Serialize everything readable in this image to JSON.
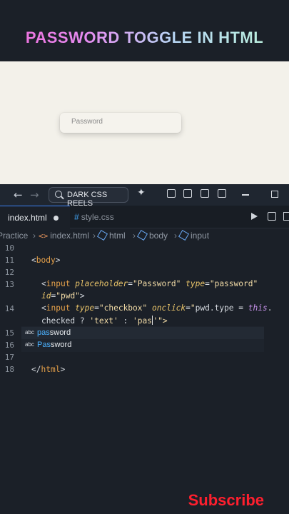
{
  "banner": {
    "title": "PASSWORD TOGGLE IN HTML"
  },
  "preview": {
    "input_placeholder": "Password"
  },
  "titlebar": {
    "back_icon": "arrow-left-icon",
    "forward_icon": "arrow-right-icon",
    "search_text": "DARK CSS REELS",
    "search_icon": "search-icon"
  },
  "tabs": [
    {
      "label": "index.html",
      "active": true,
      "modified": true
    },
    {
      "label": "style.css",
      "active": false,
      "prefix": "#"
    }
  ],
  "breadcrumb": {
    "items": [
      "Practice",
      "index.html",
      "html",
      "body",
      "input"
    ]
  },
  "editor": {
    "line_numbers": [
      "10",
      "11",
      "12",
      "13",
      "",
      "14",
      "",
      "15",
      "16",
      "17",
      "18"
    ],
    "lines": {
      "l11": {
        "open": "<",
        "name": "body",
        "close": ">"
      },
      "l13": {
        "open": "<",
        "tag": "input",
        "attr1": "placeholder",
        "eq1": "=",
        "val1": "\"Password\"",
        "attr2": "type",
        "eq2": "=",
        "val2": "\"password\"",
        "attr3": "id",
        "eq3": "=",
        "val3": "\"pwd\"",
        "close": ">"
      },
      "l14": {
        "open": "<",
        "tag": "input",
        "attr1": "type",
        "eq1": "=",
        "val1": "\"checkbox\"",
        "attr2": "onclick",
        "eq2": "=",
        "q": "\"",
        "js1": "pwd.type = ",
        "kw": "this",
        "js2": ".",
        "js3": "checked ? ",
        "s1": "'text'",
        "js4": " : ",
        "s2": "'pas",
        "s3": "'\">"
      },
      "l18": {
        "open": "</",
        "name": "html",
        "close": ">"
      }
    }
  },
  "suggest": {
    "items": [
      {
        "kind": "abc",
        "match": "pas",
        "rest": "sword",
        "selected": true
      },
      {
        "kind": "abc",
        "match": "Pas",
        "rest": "sword",
        "selected": false
      }
    ]
  },
  "overlay": {
    "subscribe": "Subscribe"
  },
  "colors": {
    "accent_blue": "#3b82f6",
    "subscribe_red": "#ff1f2e",
    "preview_bg": "#f3f1ea"
  }
}
